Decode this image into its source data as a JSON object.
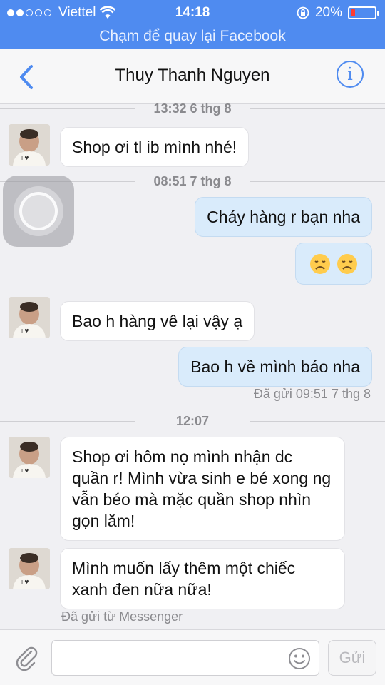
{
  "status_bar": {
    "carrier": "Viettel",
    "time": "14:18",
    "battery": "20%",
    "battery_level": 0.2
  },
  "return_banner": "Chạm để quay lại Facebook",
  "nav": {
    "title": "Thuy Thanh Nguyen",
    "back_icon": "chevron-left-icon",
    "info_icon": "info-icon"
  },
  "chat": {
    "dividers": [
      "13:32 6 thg 8",
      "08:51 7 thg 8",
      "12:07"
    ],
    "messages": [
      {
        "from": "contact",
        "text": "Shop ơi tl ib mình nhé!"
      },
      {
        "from": "me",
        "text": "Cháy hàng r bạn nha"
      },
      {
        "from": "me",
        "text": "😞😞"
      },
      {
        "from": "contact",
        "text": "Bao h hàng vê lại vậy ạ"
      },
      {
        "from": "me",
        "text": "Bao h về mình báo nha"
      },
      {
        "from": "contact",
        "text": "Shop ơi hôm nọ mình nhận dc quần r! Mình vừa sinh e bé xong ng vẫn béo mà mặc quần shop nhìn gọn lăm!"
      },
      {
        "from": "contact",
        "text": "Mình muốn lấy thêm một chiếc xanh đen nữa nữa!"
      }
    ],
    "sent_status": "Đã gửi 09:51 7 thg 8",
    "sent_via": "Đã gửi từ Messenger"
  },
  "composer": {
    "placeholder": "",
    "send_label": "Gửi",
    "attach_icon": "paperclip-icon",
    "emoji_icon": "smiley-icon"
  },
  "colors": {
    "brand_blue": "#4f8bf0",
    "outgoing_bubble": "#d9ebfb",
    "incoming_bubble": "#ffffff"
  }
}
